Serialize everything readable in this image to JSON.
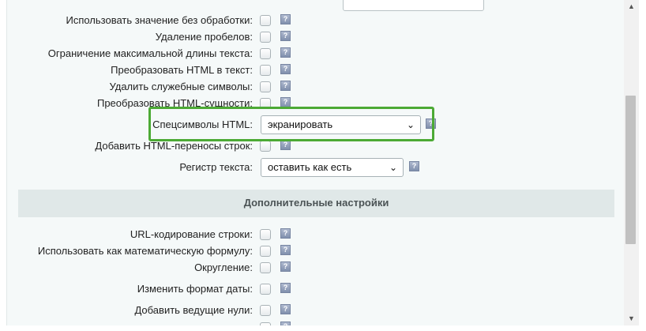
{
  "fields_top": [
    {
      "label": "Использовать значение без обработки:"
    },
    {
      "label": "Удаление пробелов:"
    },
    {
      "label": "Ограничение максимальной длины текста:"
    },
    {
      "label": "Преобразовать HTML в текст:"
    },
    {
      "label": "Удалить служебные символы:"
    },
    {
      "label": "Преобразовать HTML-сущности:"
    }
  ],
  "html_specials": {
    "label": "Спецсимволы HTML:",
    "value": "экранировать"
  },
  "html_breaks": {
    "label": "Добавить HTML-переносы строк:"
  },
  "text_case": {
    "label": "Регистр текста:",
    "value": "оставить как есть"
  },
  "section_title": "Дополнительные настройки",
  "fields_bottom": [
    {
      "label": "URL-кодирование строки:"
    },
    {
      "label": "Использовать как математическую формулу:"
    },
    {
      "label": "Округление:"
    },
    {
      "label": "Изменить формат даты:"
    },
    {
      "label": "Добавить ведущие нули:"
    }
  ],
  "help_glyph": "?",
  "chevron_glyph": "⌄",
  "scroll_up_glyph": "▲",
  "scroll_down_glyph": "▼",
  "colors": {
    "highlight": "#4caa35",
    "section_bg": "#e0e8e8",
    "panel_bg": "#f5f9f9"
  }
}
